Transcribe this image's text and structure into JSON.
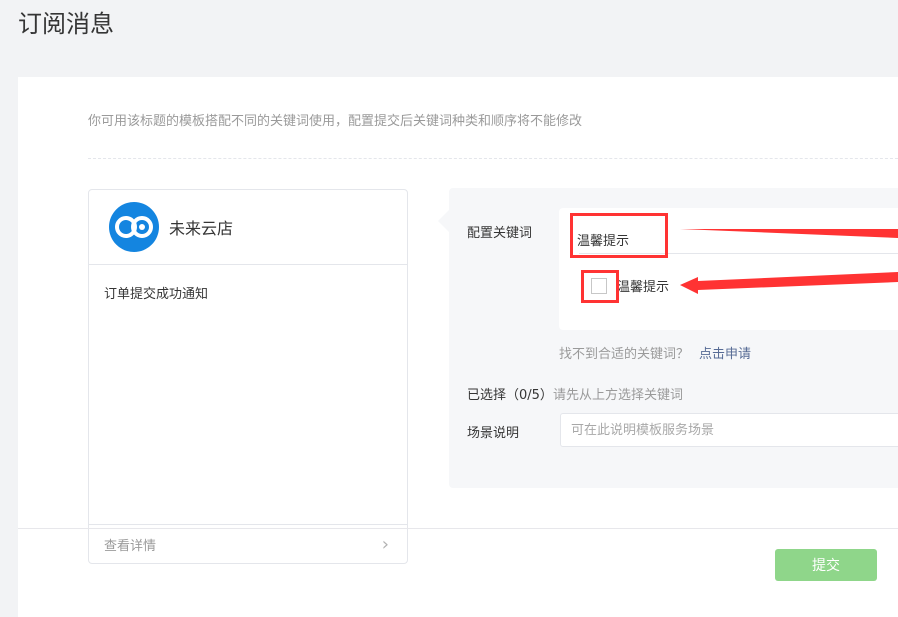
{
  "page_title": "订阅消息",
  "tip": "你可用该标题的模板搭配不同的关键词使用，配置提交后关键词种类和顺序将不能修改",
  "preview": {
    "brand": "未来云店",
    "template_name": "订单提交成功通知",
    "detail_label": "查看详情"
  },
  "form": {
    "keyword_label": "配置关键词",
    "keyword_tab": "温馨提示",
    "keyword_option": "温馨提示",
    "apply_prompt": "找不到合适的关键词？",
    "apply_link": "点击申请",
    "selected_label": "已选择（0/5）",
    "selected_hint": "请先从上方选择关键词",
    "scene_label": "场景说明",
    "scene_placeholder": "可在此说明模板服务场景",
    "submit_label": "提交"
  },
  "colors": {
    "accent": "#8fd68a",
    "link": "#576b95",
    "annotation": "#ff3333"
  }
}
